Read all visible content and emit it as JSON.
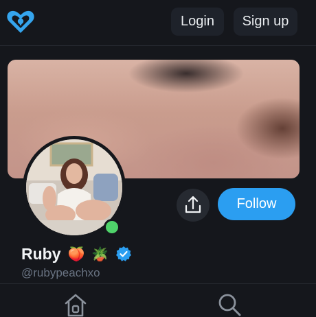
{
  "header": {
    "logo_icon": "heart-lock-icon",
    "login_label": "Login",
    "signup_label": "Sign up"
  },
  "profile": {
    "name": "Ruby",
    "emojis": [
      "🍑",
      "🪴"
    ],
    "handle": "@rubypeachxo",
    "verified": true,
    "online": true,
    "follow_label": "Follow",
    "share_icon": "share-icon"
  },
  "bottom_nav": {
    "items": [
      "home-icon",
      "search-icon"
    ]
  },
  "colors": {
    "background": "#15171c",
    "accent": "#2b9ef1",
    "button_bg": "#1e222a",
    "online": "#4fd36a",
    "handle_text": "#697382"
  }
}
